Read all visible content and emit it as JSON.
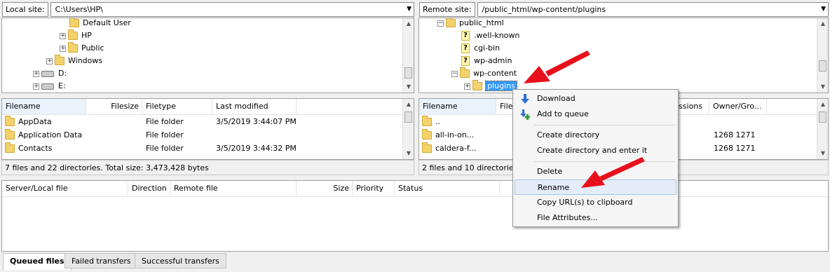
{
  "local": {
    "site_label": "Local site:",
    "path": "C:\\Users\\HP\\",
    "tree": [
      "Default User",
      "HP",
      "Public",
      "Windows",
      "D:",
      "E:"
    ],
    "columns": [
      "Filename",
      "Filesize",
      "Filetype",
      "Last modified"
    ],
    "files": [
      {
        "name": "AppData",
        "type": "File folder",
        "modified": "3/5/2019 3:44:07 PM"
      },
      {
        "name": "Application Data",
        "type": "File folder",
        "modified": ""
      },
      {
        "name": "Contacts",
        "type": "File folder",
        "modified": "3/5/2019 3:44:32 PM"
      }
    ],
    "status": "7 files and 22 directories. Total size: 3,473,428 bytes"
  },
  "remote": {
    "site_label": "Remote site:",
    "path": "/public_html/wp-content/plugins",
    "tree": [
      "public_html",
      ".well-known",
      "cgi-bin",
      "wp-admin",
      "wp-content",
      "plugins"
    ],
    "columns": [
      "Filename",
      "Filesize",
      "issions",
      "Owner/Gro..."
    ],
    "files": [
      {
        "name": "..",
        "owner": ""
      },
      {
        "name": "all-in-on...",
        "owner": "1268 1271"
      },
      {
        "name": "caldera-f...",
        "owner": "1268 1271"
      }
    ],
    "status": "2 files and 10 directories."
  },
  "queue": {
    "columns": [
      "Server/Local file",
      "Direction",
      "Remote file",
      "Size",
      "Priority",
      "Status"
    ],
    "tabs": [
      "Queued files",
      "Failed transfers",
      "Successful transfers"
    ]
  },
  "context_menu": {
    "items": [
      "Download",
      "Add to queue",
      "Create directory",
      "Create directory and enter it",
      "Delete",
      "Rename",
      "Copy URL(s) to clipboard",
      "File Attributes..."
    ],
    "highlighted": "Rename"
  },
  "colors": {
    "annotation_arrow": "#e8101b",
    "selection": "#3399ff"
  }
}
